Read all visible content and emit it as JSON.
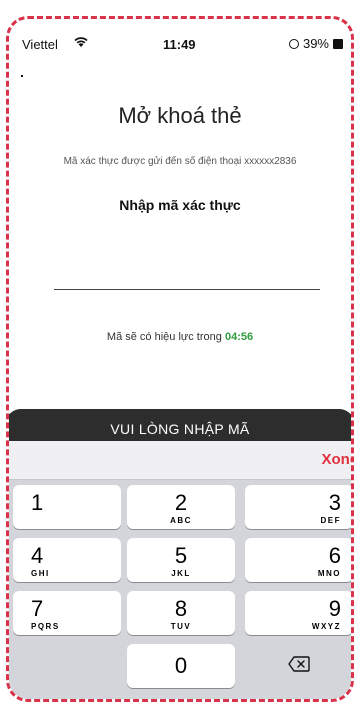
{
  "status_bar": {
    "carrier": "Viettel",
    "time": "11:49",
    "battery": "39%"
  },
  "page": {
    "title": "Mở khoá thẻ",
    "subtitle": "Mã xác thực được gửi đến số điện thoại xxxxxx2836",
    "code_heading": "Nhập mã xác thực",
    "validity_prefix": "Mã sẽ có hiệu lực trong",
    "countdown": "04:56"
  },
  "cta": {
    "label": "VUI LÒNG NHẬP MÃ"
  },
  "keyboard": {
    "done_label": "Xong",
    "keys": [
      {
        "digit": "1",
        "letters": ""
      },
      {
        "digit": "2",
        "letters": "ABC"
      },
      {
        "digit": "3",
        "letters": "DEF"
      },
      {
        "digit": "4",
        "letters": "GHI"
      },
      {
        "digit": "5",
        "letters": "JKL"
      },
      {
        "digit": "6",
        "letters": "MNO"
      },
      {
        "digit": "7",
        "letters": "PQRS"
      },
      {
        "digit": "8",
        "letters": "TUV"
      },
      {
        "digit": "9",
        "letters": "WXYZ"
      },
      {
        "digit": "0",
        "letters": ""
      }
    ]
  }
}
